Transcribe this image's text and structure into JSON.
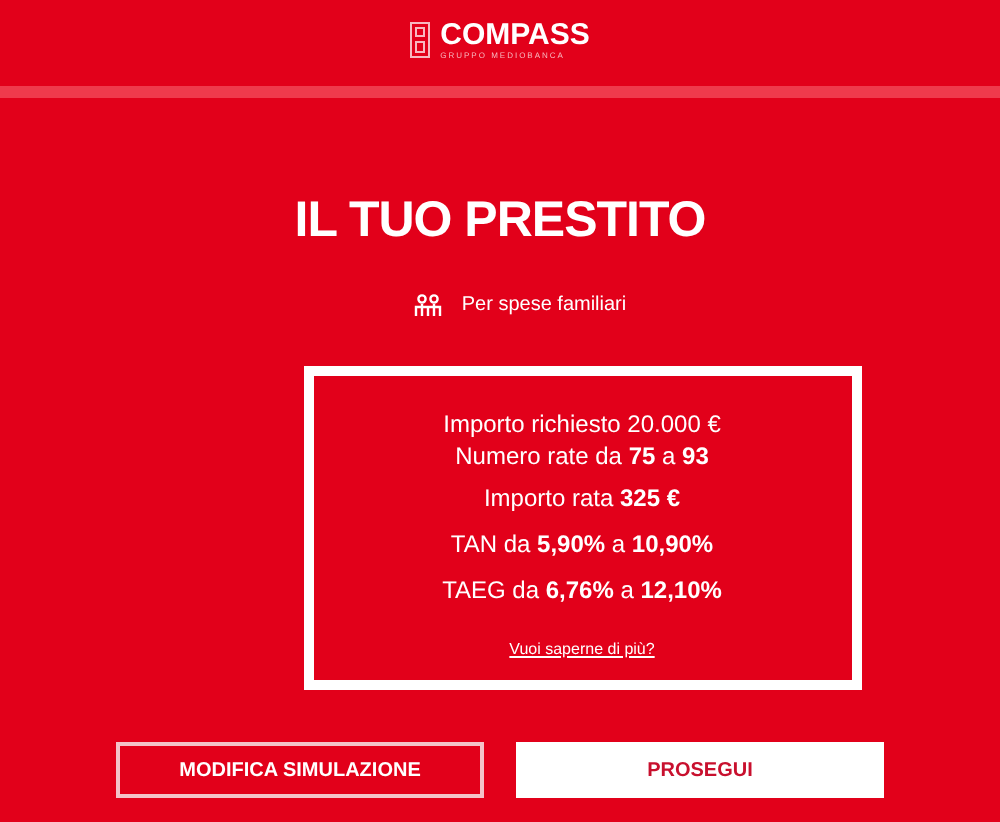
{
  "header": {
    "brand": "COMPASS",
    "tagline": "GRUPPO MEDIOBANCA"
  },
  "title": "IL TUO PRESTITO",
  "purpose": "Per spese familiari",
  "summary": {
    "lines": [
      "Importo richiesto 20.000 €",
      "Numero rate da **75** a **93**",
      "Importo rata **325 €**",
      "TAN da **5,90%** a **10,90%**",
      "TAEG da **6,76%** a **12,10%**"
    ],
    "link": "Vuoi saperne di più?"
  },
  "buttons": [
    {
      "label": "MODIFICA SIMULAZIONE",
      "kind": "outline"
    },
    {
      "label": "PROSEGUI",
      "kind": "filled"
    }
  ]
}
